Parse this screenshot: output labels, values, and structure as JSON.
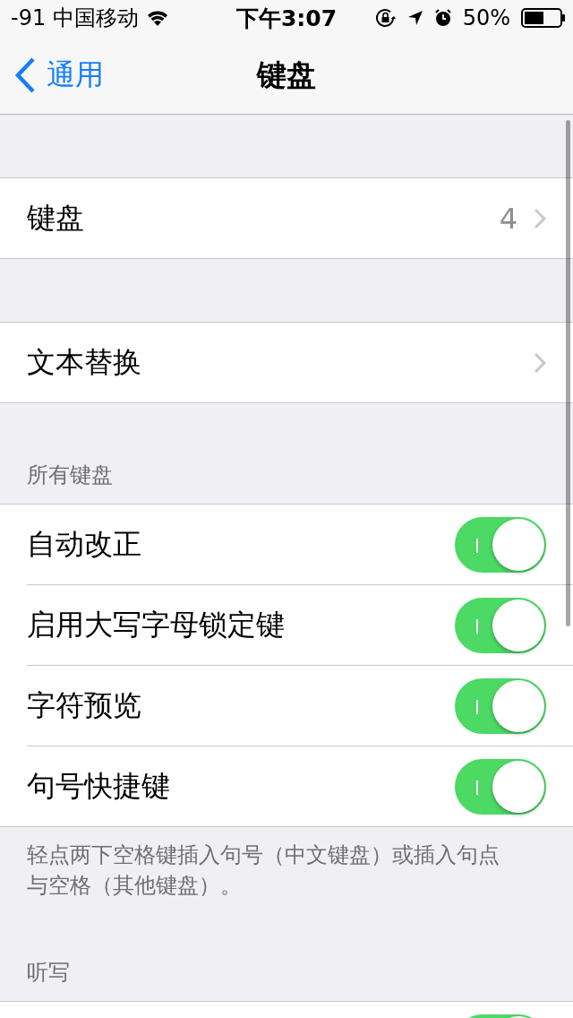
{
  "status_bar": {
    "signal": "-91",
    "carrier": "中国移动",
    "time": "下午3:07",
    "battery": "50%"
  },
  "nav": {
    "back": "通用",
    "title": "键盘"
  },
  "sections": [
    {
      "rows": [
        {
          "kind": "link",
          "label": "键盘",
          "value": "4"
        }
      ]
    },
    {
      "rows": [
        {
          "kind": "link",
          "label": "文本替换"
        }
      ]
    },
    {
      "header": "所有键盘",
      "rows": [
        {
          "kind": "toggle",
          "label": "自动改正",
          "on": true
        },
        {
          "kind": "toggle",
          "label": "启用大写字母锁定键",
          "on": true
        },
        {
          "kind": "toggle",
          "label": "字符预览",
          "on": true
        },
        {
          "kind": "toggle",
          "label": "句号快捷键",
          "on": true
        }
      ],
      "footer": "轻点两下空格键插入句号（中文键盘）或插入句点与空格（其他键盘）。"
    },
    {
      "header": "听写",
      "rows": [
        {
          "kind": "toggle",
          "on": true
        }
      ]
    }
  ]
}
